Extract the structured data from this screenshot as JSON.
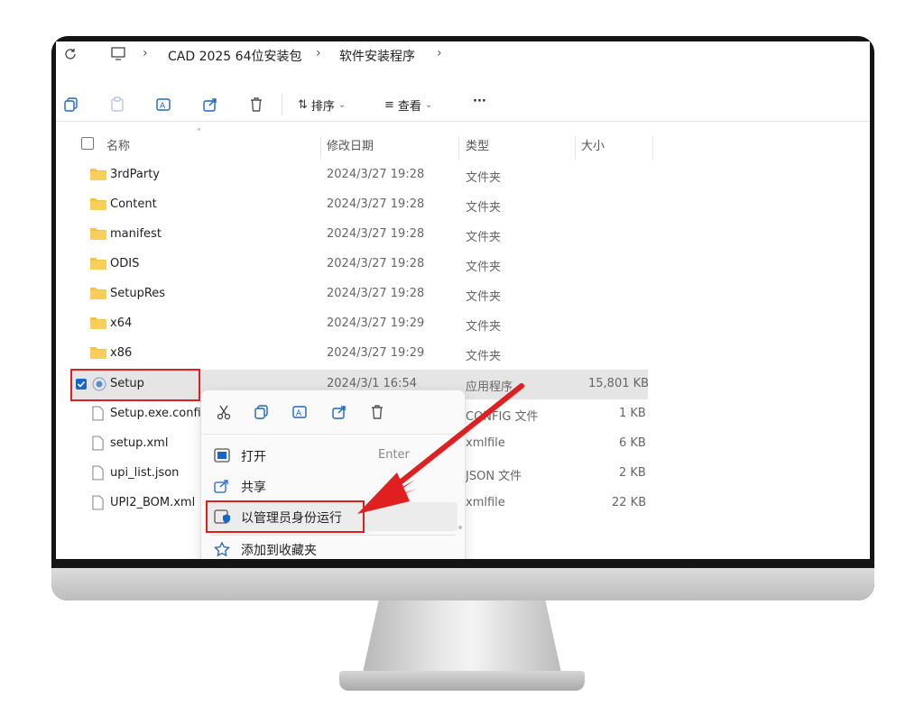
{
  "breadcrumb": {
    "items": [
      "CAD 2025 64位安装包",
      "软件安装程序"
    ]
  },
  "toolbar": {
    "sort_label": "排序",
    "view_label": "查看",
    "more_label": "···"
  },
  "columns": {
    "name": "名称",
    "modified": "修改日期",
    "type": "类型",
    "size": "大小"
  },
  "files": [
    {
      "name": "3rdParty",
      "modified": "2024/3/27 19:28",
      "type": "文件夹",
      "size": "",
      "icon": "folder-icon"
    },
    {
      "name": "Content",
      "modified": "2024/3/27 19:28",
      "type": "文件夹",
      "size": "",
      "icon": "folder-icon"
    },
    {
      "name": "manifest",
      "modified": "2024/3/27 19:28",
      "type": "文件夹",
      "size": "",
      "icon": "folder-icon"
    },
    {
      "name": "ODIS",
      "modified": "2024/3/27 19:28",
      "type": "文件夹",
      "size": "",
      "icon": "folder-icon"
    },
    {
      "name": "SetupRes",
      "modified": "2024/3/27 19:28",
      "type": "文件夹",
      "size": "",
      "icon": "folder-icon"
    },
    {
      "name": "x64",
      "modified": "2024/3/27 19:29",
      "type": "文件夹",
      "size": "",
      "icon": "folder-icon"
    },
    {
      "name": "x86",
      "modified": "2024/3/27 19:29",
      "type": "文件夹",
      "size": "",
      "icon": "folder-icon"
    },
    {
      "name": "Setup",
      "modified": "2024/3/1 16:54",
      "type": "应用程序",
      "size": "15,801 KB",
      "icon": "setup-app-icon",
      "selected": true
    },
    {
      "name": "Setup.exe.config",
      "modified": "",
      "type": "CONFIG 文件",
      "size": "1 KB",
      "icon": "file-icon"
    },
    {
      "name": "setup.xml",
      "modified": "",
      "type": "xmlfile",
      "size": "6 KB",
      "icon": "file-icon"
    },
    {
      "name": "upi_list.json",
      "modified": "",
      "type": "JSON 文件",
      "size": "2 KB",
      "icon": "file-icon"
    },
    {
      "name": "UPI2_BOM.xml",
      "modified": "",
      "type": "xmlfile",
      "size": "22 KB",
      "icon": "file-icon"
    }
  ],
  "context_menu": {
    "quick_actions": [
      "cut-icon",
      "copy-icon",
      "rename-icon",
      "share-icon",
      "delete-icon"
    ],
    "items": [
      {
        "label": "打开",
        "shortcut": "Enter",
        "icon": "open-icon"
      },
      {
        "label": "共享",
        "shortcut": "",
        "icon": "share-icon"
      },
      {
        "label": "以管理员身份运行",
        "shortcut": "",
        "icon": "shield-icon",
        "highlighted": true
      },
      {
        "label": "添加到收藏夹",
        "shortcut": "",
        "icon": "star-icon"
      }
    ]
  },
  "colors": {
    "annotation_red": "#e02020",
    "folder_yellow": "#f5c242",
    "selection": "#e5e5e5",
    "accent_blue": "#1a66c4"
  }
}
